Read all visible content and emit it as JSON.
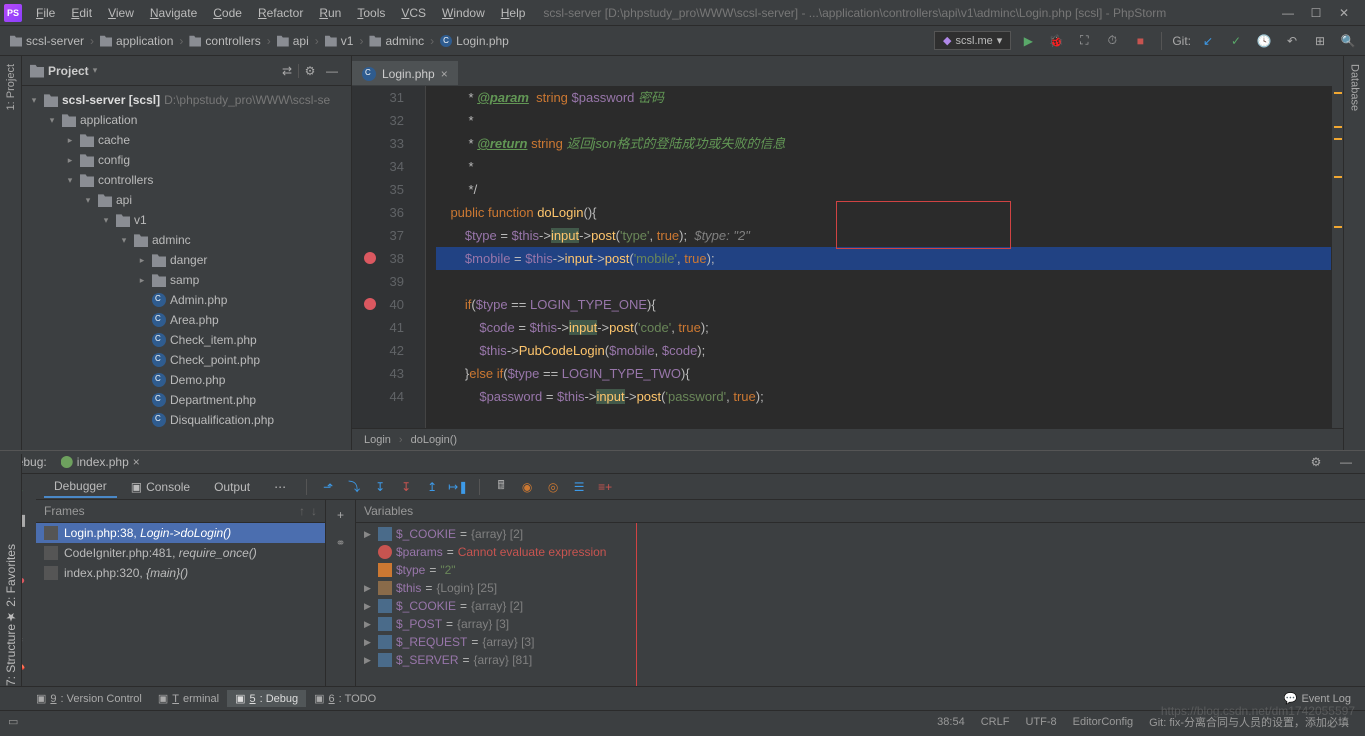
{
  "title_path": "scsl-server [D:\\phpstudy_pro\\WWW\\scsl-server] - ...\\application\\controllers\\api\\v1\\adminc\\Login.php [scsl] - PhpStorm",
  "menu": [
    "File",
    "Edit",
    "View",
    "Navigate",
    "Code",
    "Refactor",
    "Run",
    "Tools",
    "VCS",
    "Window",
    "Help"
  ],
  "crumbs": [
    {
      "icon": "folder",
      "label": "scsl-server"
    },
    {
      "icon": "folder",
      "label": "application"
    },
    {
      "icon": "folder",
      "label": "controllers"
    },
    {
      "icon": "folder",
      "label": "api"
    },
    {
      "icon": "folder",
      "label": "v1"
    },
    {
      "icon": "folder",
      "label": "adminc"
    },
    {
      "icon": "php",
      "label": "Login.php"
    }
  ],
  "run_target": "scsl.me",
  "git_label": "Git:",
  "project_label": "Project",
  "tree": {
    "root": "scsl-server",
    "root_suffix": "[scsl]",
    "root_path": "D:\\phpstudy_pro\\WWW\\scsl-se",
    "nodes": [
      {
        "d": 1,
        "t": "folder",
        "open": true,
        "name": "application"
      },
      {
        "d": 2,
        "t": "folder",
        "open": false,
        "name": "cache"
      },
      {
        "d": 2,
        "t": "folder",
        "open": false,
        "name": "config"
      },
      {
        "d": 2,
        "t": "folder",
        "open": true,
        "name": "controllers"
      },
      {
        "d": 3,
        "t": "folder",
        "open": true,
        "name": "api"
      },
      {
        "d": 4,
        "t": "folder",
        "open": true,
        "name": "v1"
      },
      {
        "d": 5,
        "t": "folder",
        "open": true,
        "name": "adminc"
      },
      {
        "d": 6,
        "t": "folder",
        "open": false,
        "name": "danger"
      },
      {
        "d": 6,
        "t": "folder",
        "open": false,
        "name": "samp"
      },
      {
        "d": 6,
        "t": "php",
        "name": "Admin.php"
      },
      {
        "d": 6,
        "t": "php",
        "name": "Area.php"
      },
      {
        "d": 6,
        "t": "php",
        "name": "Check_item.php"
      },
      {
        "d": 6,
        "t": "php",
        "name": "Check_point.php"
      },
      {
        "d": 6,
        "t": "php",
        "name": "Demo.php"
      },
      {
        "d": 6,
        "t": "php",
        "name": "Department.php"
      },
      {
        "d": 6,
        "t": "php",
        "name": "Disqualification.php"
      }
    ]
  },
  "editor_tab": "Login.php",
  "lines_start": 31,
  "lines": [
    " * <tag>@param</tag>  <k>string</k> <v>$password</v> <c>密码</c>",
    " *",
    " * <tag>@return</tag> <k>string</k> <c>返回json格式的登陆成功或失败的信息</c>",
    " *",
    " */",
    "<o>public function</o> <y>doLogin</y>(){",
    "    <v>$type</v> = <v>$this</v>-><hl>input</hl>-><y>post</y>(<g>'type'</g>, <o>true</o>);  <i>$type: \"2\"</i>",
    "    <v>$mobile</v> = <v>$this</v>-><y>input</y>-><y>post</y>(<g>'mobile'</g>, <o>true</o>);",
    "",
    "    <o>if</o>(<v>$type</v> == <v>LOGIN_TYPE_ONE</v>){",
    "        <v>$code</v> = <v>$this</v>-><hl>input</hl>-><y>post</y>(<g>'code'</g>, <o>true</o>);",
    "        <v>$this</v>-><y>PubCodeLogin</y>(<v>$mobile</v>, <v>$code</v>);",
    "    }<o>else if</o>(<v>$type</v> == <v>LOGIN_TYPE_TWO</v>){",
    "        <v>$password</v> = <v>$this</v>-><hl>input</hl>-><y>post</y>(<g>'password'</g>, <o>true</o>);"
  ],
  "breakpoints": [
    38,
    40
  ],
  "current_line": 38,
  "breadcrumb_fn": [
    "Login",
    "doLogin()"
  ],
  "debug": {
    "title": "Debug:",
    "file": "index.php",
    "tabs": [
      "Debugger",
      "Console",
      "Output"
    ],
    "frames_title": "Frames",
    "frames": [
      {
        "label": "Login.php:38, ",
        "fn": "Login->doLogin()",
        "sel": true
      },
      {
        "label": "CodeIgniter.php:481, ",
        "fn": "require_once()",
        "sel": false
      },
      {
        "label": "index.php:320, ",
        "fn": "{main}()",
        "sel": false
      }
    ],
    "vars_title": "Variables",
    "vars": [
      {
        "ic": "arr",
        "tw": "▶",
        "name": "$_COOKIE",
        "eq": " = ",
        "val": "{array} [2]"
      },
      {
        "ic": "err",
        "tw": "",
        "name": "$params",
        "eq": " = ",
        "err": "Cannot evaluate expression"
      },
      {
        "ic": "str",
        "tw": "",
        "name": "$type",
        "eq": " = ",
        "str": "\"2\""
      },
      {
        "ic": "obj",
        "tw": "▶",
        "name": "$this",
        "eq": " = ",
        "val": "{Login} [25]"
      },
      {
        "ic": "arr",
        "tw": "▶",
        "name": "$_COOKIE",
        "eq": " = ",
        "val": "{array} [2]"
      },
      {
        "ic": "arr",
        "tw": "▶",
        "name": "$_POST",
        "eq": " = ",
        "val": "{array} [3]"
      },
      {
        "ic": "arr",
        "tw": "▶",
        "name": "$_REQUEST",
        "eq": " = ",
        "val": "{array} [3]"
      },
      {
        "ic": "arr",
        "tw": "▶",
        "name": "$_SERVER",
        "eq": " = ",
        "val": "{array} [81]"
      }
    ]
  },
  "bottom_tabs": [
    {
      "label": "9: Version Control"
    },
    {
      "label": "Terminal"
    },
    {
      "label": "5: Debug",
      "act": true
    },
    {
      "label": "6: TODO"
    }
  ],
  "event_log": "Event Log",
  "status": {
    "pos": "38:54",
    "eol": "CRLF",
    "enc": "UTF-8",
    "cfg": "EditorConfig",
    "git": "Git: fix-分离合同与人员的设置，添加必填"
  },
  "watermark": "https://blog.csdn.net/dm1742055597",
  "left_tabs": [
    "1: Project"
  ],
  "left_tabs2": [
    "2: Favorites",
    "7: Structure"
  ],
  "right_tab": "Database"
}
